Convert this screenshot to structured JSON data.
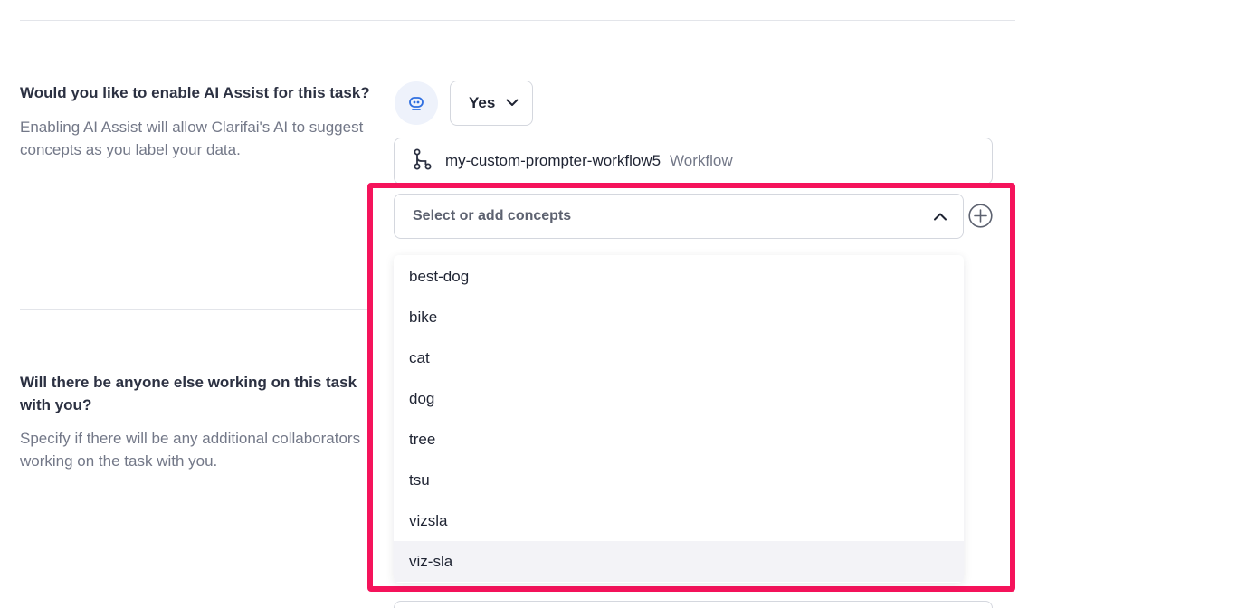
{
  "ai_assist": {
    "title": "Would you like to enable AI Assist for this task?",
    "description": "Enabling AI Assist will allow Clarifai's AI to suggest concepts as you label your data.",
    "icon": "robot-icon",
    "toggle": {
      "value": "Yes"
    },
    "workflow": {
      "name": "my-custom-prompter-workflow5",
      "type": "Workflow",
      "icon": "workflow-branch-icon"
    },
    "concepts": {
      "placeholder": "Select or add concepts",
      "options": [
        "best-dog",
        "bike",
        "cat",
        "dog",
        "tree",
        "tsu",
        "vizsla",
        "viz-sla"
      ],
      "highlighted_option": "viz-sla"
    }
  },
  "collaborators": {
    "title": "Will there be anyone else working on this task with you?",
    "description": "Specify if there will be any additional collaborators working on the task with you."
  },
  "colors": {
    "highlight_border": "#f5135b",
    "accent_blue": "#2f6fe0",
    "text_primary": "#1f2433",
    "text_secondary": "#737888"
  }
}
